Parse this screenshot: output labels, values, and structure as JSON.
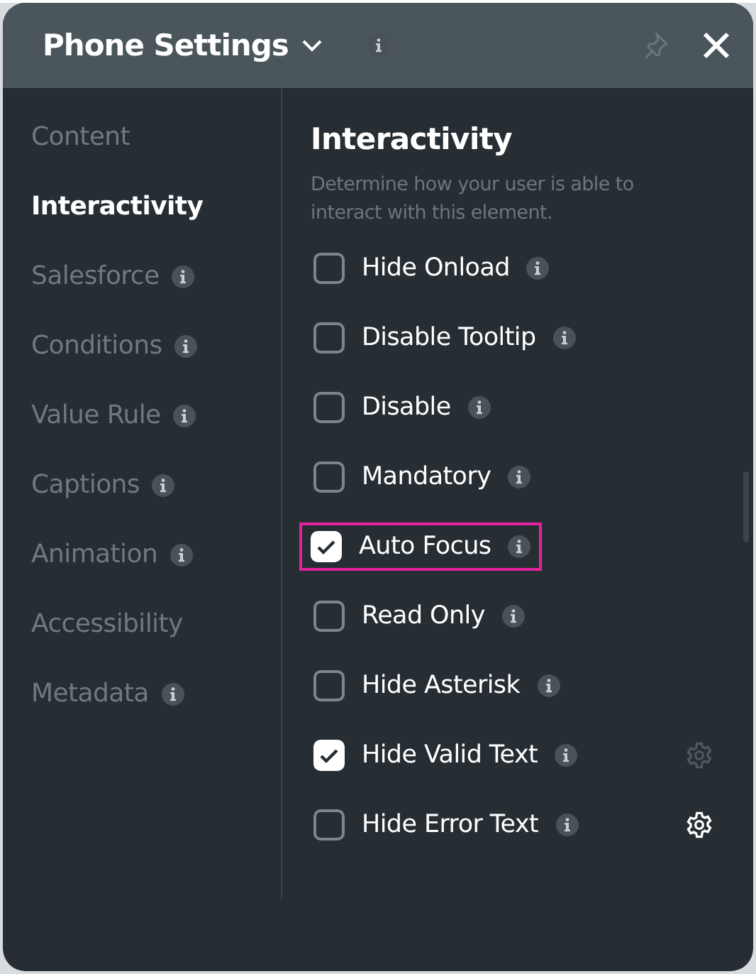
{
  "window": {
    "title": "Phone Settings"
  },
  "sidebar": {
    "items": [
      {
        "label": "Content",
        "selected": false,
        "info": false
      },
      {
        "label": "Interactivity",
        "selected": true,
        "info": false
      },
      {
        "label": "Salesforce",
        "selected": false,
        "info": true
      },
      {
        "label": "Conditions",
        "selected": false,
        "info": true
      },
      {
        "label": "Value Rule",
        "selected": false,
        "info": true
      },
      {
        "label": "Captions",
        "selected": false,
        "info": true
      },
      {
        "label": "Animation",
        "selected": false,
        "info": true
      },
      {
        "label": "Accessibility",
        "selected": false,
        "info": false
      },
      {
        "label": "Metadata",
        "selected": false,
        "info": true
      }
    ]
  },
  "section": {
    "title": "Interactivity",
    "description": "Determine how your user is able to interact with this element.",
    "options": [
      {
        "label": "Hide Onload",
        "checked": false,
        "highlighted": false
      },
      {
        "label": "Disable Tooltip",
        "checked": false,
        "highlighted": false
      },
      {
        "label": "Disable",
        "checked": false,
        "highlighted": false
      },
      {
        "label": "Mandatory",
        "checked": false,
        "highlighted": false
      },
      {
        "label": "Auto Focus",
        "checked": true,
        "highlighted": true
      },
      {
        "label": "Read Only",
        "checked": false,
        "highlighted": false
      },
      {
        "label": "Hide Asterisk",
        "checked": false,
        "highlighted": false
      },
      {
        "label": "Hide Valid Text",
        "checked": true,
        "highlighted": false,
        "gear": {
          "disabled": true
        }
      },
      {
        "label": "Hide Error Text",
        "checked": false,
        "highlighted": false,
        "gear": {
          "disabled": false
        }
      }
    ]
  }
}
